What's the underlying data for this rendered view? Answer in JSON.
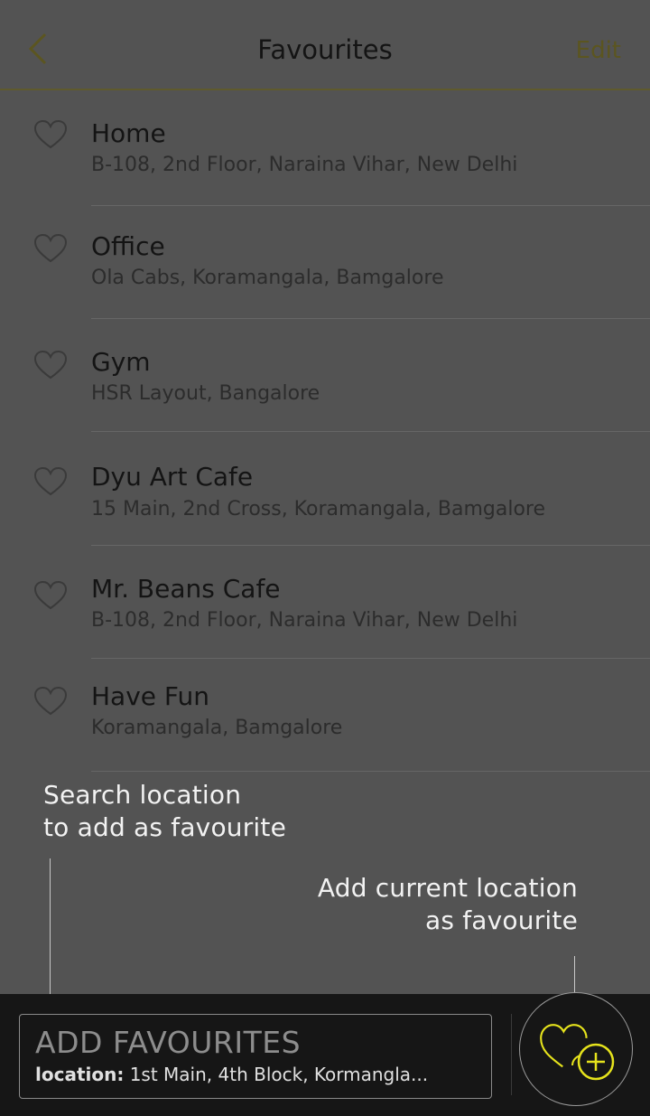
{
  "header": {
    "title": "Favourites",
    "edit_label": "Edit",
    "back_icon": "chevron-left-icon"
  },
  "favourites": [
    {
      "name": "Home",
      "address": "B-108, 2nd Floor, Naraina Vihar, New Delhi"
    },
    {
      "name": "Office",
      "address": "Ola Cabs, Koramangala, Bamgalore"
    },
    {
      "name": "Gym",
      "address": "HSR Layout, Bangalore"
    },
    {
      "name": "Dyu Art Cafe",
      "address": "15 Main, 2nd Cross, Koramangala, Bamgalore"
    },
    {
      "name": "Mr. Beans Cafe",
      "address": "B-108, 2nd Floor, Naraina Vihar, New Delhi"
    },
    {
      "name": "Have Fun",
      "address": "Koramangala, Bamgalore"
    }
  ],
  "hints": {
    "search_line1": "Search location",
    "search_line2": "to add as favourite",
    "current_line1": "Add current location",
    "current_line2": "as favourite"
  },
  "bottom": {
    "title": "ADD FAVOURITES",
    "location_label": "location:",
    "location_value": "1st Main, 4th Block, Kormangla..."
  },
  "colors": {
    "overlay_background": "#535353",
    "accent": "#e6e31c",
    "header_accent": "#5b5520",
    "bottom_bar": "#161616"
  }
}
